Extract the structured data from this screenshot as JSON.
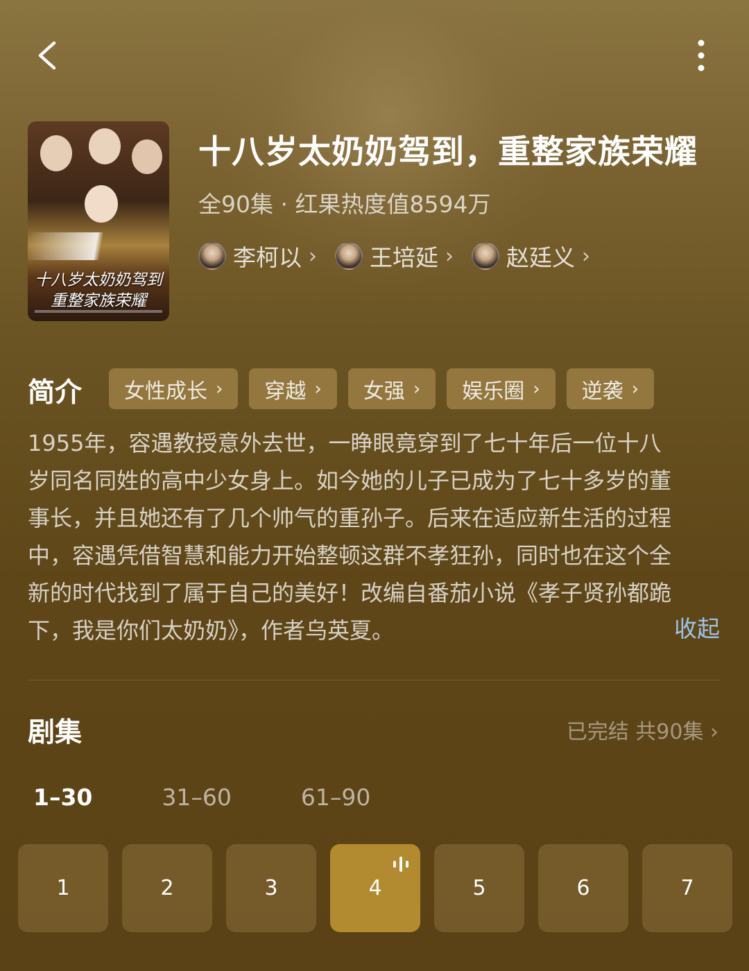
{
  "header": {
    "back_icon": "chevron-left-icon",
    "more_icon": "more-vertical-icon"
  },
  "cover": {
    "title_lines": [
      "十八岁太奶奶驾到",
      "重整家族荣耀"
    ]
  },
  "drama": {
    "title": "十八岁太奶奶驾到，重整家族荣耀",
    "meta": "全90集 · 红果热度值8594万",
    "actors": [
      {
        "name": "李柯以",
        "icon": "chevron-right-icon"
      },
      {
        "name": "王培延",
        "icon": "chevron-right-icon"
      },
      {
        "name": "赵廷义",
        "icon": "chevron-right-icon"
      }
    ]
  },
  "intro": {
    "heading": "简介",
    "tags": [
      "女性成长",
      "穿越",
      "女强",
      "娱乐圈",
      "逆袭"
    ],
    "synopsis_lines": [
      "1955年，容遇教授意外去世，一睁眼竟穿到了七十年后一位十八",
      "岁同名同姓的高中少女身上。如今她的儿子已成为了七十多岁的董",
      "事长，并且她还有了几个帅气的重孙子。后来在适应新生活的过程",
      "中，容遇凭借智慧和能力开始整顿这群不孝狂孙，同时也在这个全",
      "新的时代找到了属于自己的美好！改编自番茄小说《孝子贤孙都跪",
      "下，我是你们太奶奶》，作者乌英夏。"
    ],
    "collapse_label": "收起"
  },
  "episodes": {
    "heading": "剧集",
    "status": "已完结 共90集",
    "ranges": [
      "1–30",
      "31–60",
      "61–90"
    ],
    "active_range": 0,
    "items": [
      "1",
      "2",
      "3",
      "4",
      "5",
      "6",
      "7"
    ],
    "playing": "4"
  },
  "colors": {
    "accent": "#b28a30",
    "link": "#9ec3e6"
  }
}
